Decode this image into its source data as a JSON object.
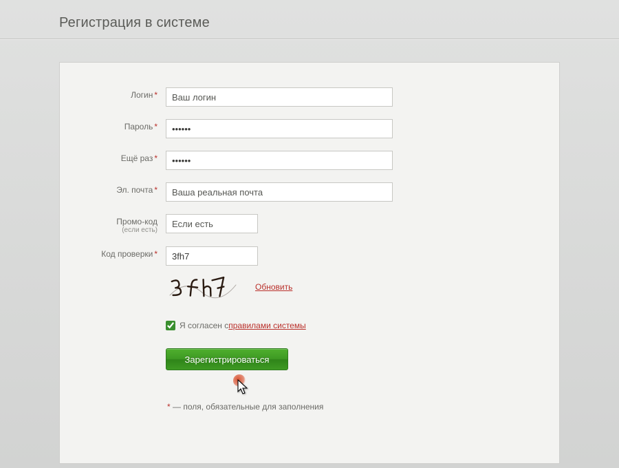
{
  "title": "Регистрация в системе",
  "required_mark": "*",
  "fields": {
    "login": {
      "label": "Логин",
      "placeholder": "Ваш логин",
      "value": ""
    },
    "password": {
      "label": "Пароль",
      "placeholder": "",
      "value": "••••••"
    },
    "confirm": {
      "label": "Ещё раз",
      "placeholder": "",
      "value": "••••••"
    },
    "email": {
      "label": "Эл. почта",
      "placeholder": "Ваша реальная почта",
      "value": ""
    },
    "promo": {
      "label": "Промо-код",
      "sublabel": "(если есть)",
      "placeholder": "Если есть",
      "value": ""
    },
    "captcha": {
      "label": "Код проверки",
      "placeholder": "",
      "value": "3fh7"
    }
  },
  "captcha_refresh": "Обновить",
  "agree": {
    "prefix": "Я согласен с ",
    "link": "правилами системы",
    "checked": true
  },
  "submit_label": "Зарегистрироваться",
  "footnote": "— поля, обязательные для заполнения"
}
